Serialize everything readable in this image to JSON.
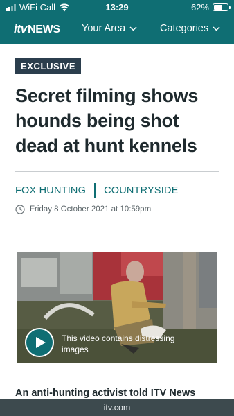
{
  "status_bar": {
    "carrier": "WiFi Call",
    "time": "13:29",
    "battery": "62%",
    "battery_level": 0.62
  },
  "nav": {
    "logo_itv": "itv",
    "logo_news": "NEWS",
    "your_area": "Your Area",
    "categories": "Categories"
  },
  "article": {
    "badge": "EXCLUSIVE",
    "headline": "Secret filming shows hounds being shot dead at hunt kennels",
    "tags": [
      "FOX HUNTING",
      "COUNTRYSIDE"
    ],
    "date": "Friday 8 October 2021 at 10:59pm",
    "video_warning": "This video contains distressing images",
    "lead": "An anti-hunting activist told ITV News"
  },
  "browser": {
    "url": "itv.com"
  },
  "colors": {
    "brand": "#0f6e73",
    "badge": "#2b3e4d",
    "text": "#1f2a2e",
    "url_bar": "#3d4a4e"
  },
  "icons": [
    "signal-icon",
    "wifi-icon",
    "battery-icon",
    "chevron-down-icon",
    "clock-icon",
    "play-icon"
  ]
}
